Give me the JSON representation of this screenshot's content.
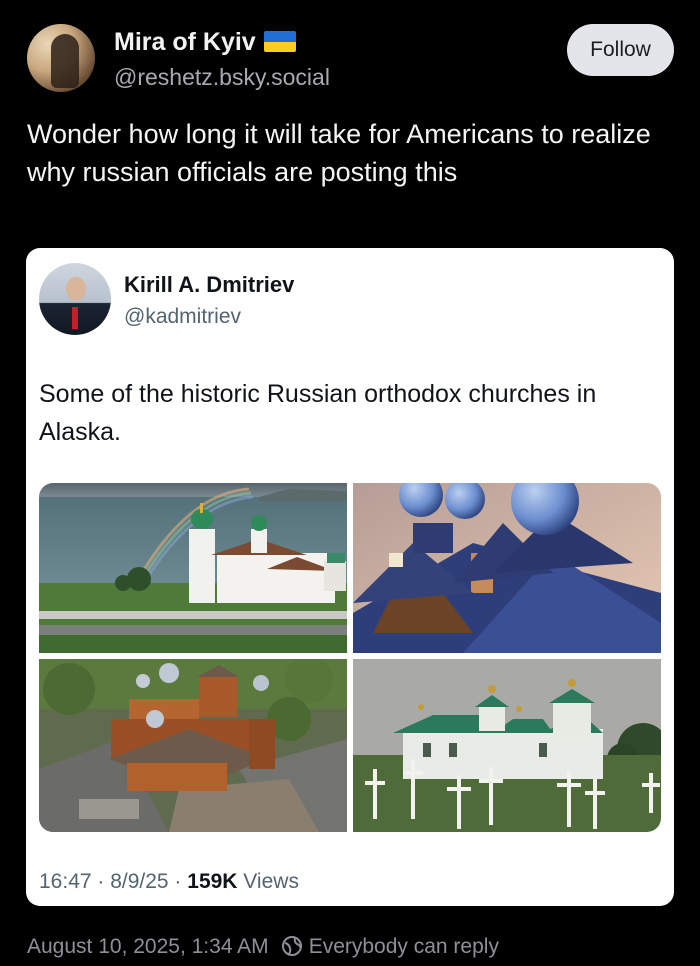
{
  "post": {
    "author_name": "Mira of Kyiv",
    "author_handle": "@reshetz.bsky.social",
    "follow_label": "Follow",
    "text": "Wonder how long it will take for Americans to realize why russian officials are posting this",
    "timestamp": "August 10, 2025, 1:34 AM",
    "reply_setting": "Everybody can reply",
    "icons": {
      "flag": "ukraine-flag-emoji",
      "reply": "globe-icon"
    }
  },
  "embed": {
    "author_name": "Kirill A. Dmitriev",
    "author_handle": "@kadmitriev",
    "text": "Some of the historic Russian orthodox churches in Alaska.",
    "meta_time": "16:47 · 8/9/25 · ",
    "meta_views_count": "159K",
    "meta_views_label": " Views"
  },
  "colors": {
    "background": "#000000",
    "card": "#ffffff",
    "follow_button": "#e3e5ea",
    "dome_green": "#2f8a5a",
    "dome_blue": "#6d8fd0"
  }
}
